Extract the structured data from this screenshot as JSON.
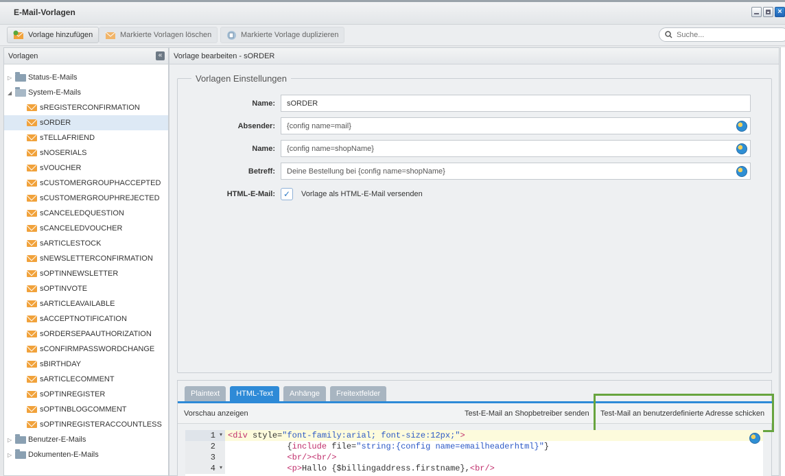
{
  "window": {
    "title": "E-Mail-Vorlagen"
  },
  "toolbar": {
    "add_label": "Vorlage hinzufügen",
    "delete_label": "Markierte Vorlagen löschen",
    "duplicate_label": "Markierte Vorlage duplizieren",
    "search_placeholder": "Suche..."
  },
  "sidebar": {
    "header": "Vorlagen",
    "folders": {
      "status": "Status-E-Mails",
      "system": "System-E-Mails",
      "user": "Benutzer-E-Mails",
      "documents": "Dokumenten-E-Mails"
    },
    "templates": [
      "sREGISTERCONFIRMATION",
      "sORDER",
      "sTELLAFRIEND",
      "sNOSERIALS",
      "sVOUCHER",
      "sCUSTOMERGROUPHACCEPTED",
      "sCUSTOMERGROUPHREJECTED",
      "sCANCELEDQUESTION",
      "sCANCELEDVOUCHER",
      "sARTICLESTOCK",
      "sNEWSLETTERCONFIRMATION",
      "sOPTINNEWSLETTER",
      "sOPTINVOTE",
      "sARTICLEAVAILABLE",
      "sACCEPTNOTIFICATION",
      "sORDERSEPAAUTHORIZATION",
      "sCONFIRMPASSWORDCHANGE",
      "sBIRTHDAY",
      "sARTICLECOMMENT",
      "sOPTINREGISTER",
      "sOPTINBLOGCOMMENT",
      "sOPTINREGISTERACCOUNTLESS"
    ],
    "selected_template": "sORDER"
  },
  "editor": {
    "header": "Vorlage bearbeiten - sORDER",
    "settings_legend": "Vorlagen Einstellungen",
    "fields": {
      "name_label": "Name:",
      "name_value": "sORDER",
      "sender_label": "Absender:",
      "sender_value": "{config name=mail}",
      "sender_name_label": "Name:",
      "sender_name_value": "{config name=shopName}",
      "subject_label": "Betreff:",
      "subject_value": "Deine Bestellung bei {config name=shopName}",
      "html_label": "HTML-E-Mail:",
      "html_checkbox_text": "Vorlage als HTML-E-Mail versenden",
      "html_checked": true
    },
    "tabs": [
      "Plaintext",
      "HTML-Text",
      "Anhänge",
      "Freitextfelder"
    ],
    "active_tab": "HTML-Text",
    "actions": {
      "preview": "Vorschau anzeigen",
      "test_owner": "Test-E-Mail an Shopbetreiber senden",
      "test_custom": "Test-Mail an benutzerdefinierte Adresse schicken"
    },
    "code_lines": [
      {
        "num": "1",
        "parts": [
          [
            "tag",
            "<div"
          ],
          [
            "txt",
            " style="
          ],
          [
            "str",
            "\"font-family:arial; font-size:12px;\""
          ],
          [
            "tag",
            ">"
          ]
        ]
      },
      {
        "num": "2",
        "parts": [
          [
            "txt",
            "            {"
          ],
          [
            "tag",
            "include"
          ],
          [
            "txt",
            " file="
          ],
          [
            "str",
            "\"string:{config name=emailheaderhtml}\""
          ],
          [
            "txt",
            "}"
          ]
        ]
      },
      {
        "num": "3",
        "parts": [
          [
            "txt",
            "            "
          ],
          [
            "tag",
            "<br/><br/>"
          ]
        ]
      },
      {
        "num": "4",
        "parts": [
          [
            "txt",
            "            "
          ],
          [
            "tag",
            "<p>"
          ],
          [
            "txt",
            "Hallo {$billingaddress.firstname},"
          ],
          [
            "tag",
            "<br/>"
          ]
        ]
      }
    ]
  },
  "colors": {
    "accent": "#2e8ad7",
    "highlight_box": "#67a43e",
    "mail_icon": "#f1a23b"
  }
}
